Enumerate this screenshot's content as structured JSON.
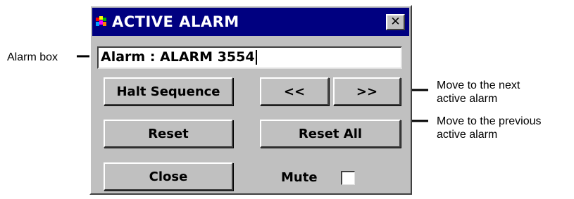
{
  "window": {
    "title": "ACTIVE ALARM",
    "close_glyph": "✕"
  },
  "alarm_field": {
    "value": "Alarm : ALARM 3554"
  },
  "buttons": {
    "halt_sequence": "Halt Sequence",
    "previous": "<<",
    "next": ">>",
    "reset": "Reset",
    "reset_all": "Reset All",
    "close": "Close"
  },
  "mute": {
    "label": "Mute",
    "checked": false
  },
  "annotations": {
    "alarm_box": "Alarm box",
    "next_line1": "Move to the next",
    "next_line2": "active alarm",
    "previous_line1": "Move to the previous",
    "previous_line2": "active alarm"
  },
  "colors": {
    "titlebar": "#000080",
    "face": "#c0c0c0",
    "field": "#ffffff"
  },
  "icons": [
    "app-icon",
    "close-icon",
    "checkbox-icon"
  ]
}
